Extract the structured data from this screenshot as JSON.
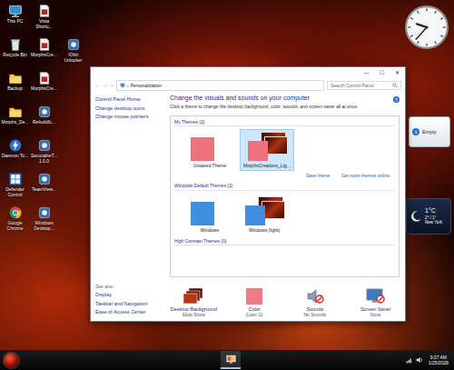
{
  "desktop_icons": [
    {
      "label": "This PC",
      "kind": "pc"
    },
    {
      "label": "Recycle Bin",
      "kind": "bin"
    },
    {
      "label": "Backup",
      "kind": "folder"
    },
    {
      "label": "Morphs_De...",
      "kind": "folder"
    },
    {
      "label": "Daemon To...",
      "kind": "lightning"
    },
    {
      "label": "Defender Control",
      "kind": "windows"
    },
    {
      "label": "Google Chrome",
      "kind": "chrome"
    },
    {
      "label": "Vista Shortc...",
      "kind": "file"
    },
    {
      "label": "MorphsCre...",
      "kind": "file"
    },
    {
      "label": "MorphsCre...",
      "kind": "file"
    },
    {
      "label": "RebuildIc...",
      "kind": "app"
    },
    {
      "label": "SecurableT... 1.0.0",
      "kind": "app"
    },
    {
      "label": "TeamView...",
      "kind": "app"
    },
    {
      "label": "Windows Desktop...",
      "kind": "app"
    },
    {
      "label": "IObit Unlocker",
      "kind": "app"
    }
  ],
  "gadgets": {
    "clock": {
      "hour": 9,
      "minute": 37
    },
    "recycle": {
      "info_icon": "i",
      "status": "Empty"
    },
    "weather": {
      "temperature": "1°C",
      "range": "2° / 1°",
      "city": "New York"
    }
  },
  "window": {
    "controls": [
      "—",
      "☐",
      "✕"
    ],
    "nav": [
      "←",
      "→",
      "↑"
    ],
    "breadcrumb": [
      "›",
      "Personalization"
    ],
    "search": {
      "placeholder": "Search Control Panel"
    },
    "help": "?"
  },
  "sidebar": {
    "links": [
      {
        "label": "Control Panel Home",
        "kind": "home"
      },
      {
        "label": "Change desktop icons",
        "kind": "link"
      },
      {
        "label": "Change mouse pointers",
        "kind": "link"
      }
    ],
    "see_also": {
      "title": "See also",
      "links": [
        "Display",
        "Taskbar and Navigation",
        "Ease of Access Center"
      ]
    }
  },
  "content": {
    "heading": "Change the visuals and sounds on your computer",
    "description": "Click a theme to change the desktop background, color, sounds, and screen saver all at once."
  },
  "theme_groups": [
    {
      "title": "My Themes (2)",
      "themes": [
        {
          "name": "Unsaved Theme",
          "selected": false,
          "kind": "color-only",
          "color": "#f0707e"
        },
        {
          "name": "MorphsCreations_Lig...",
          "selected": true,
          "kind": "with-images",
          "color": "#f0707e"
        }
      ],
      "links": [
        "Save theme",
        "Get more themes online"
      ]
    },
    {
      "title": "Windows Default Themes (2)",
      "themes": [
        {
          "name": "Windows",
          "selected": false,
          "kind": "color-only",
          "color": "#3d8fe0"
        },
        {
          "name": "Windows (light)",
          "selected": false,
          "kind": "with-images",
          "color": "#3d8fe0"
        }
      ],
      "links": []
    },
    {
      "title": "High Contrast Themes (0)",
      "themes": [],
      "links": []
    }
  ],
  "settings": [
    {
      "label": "Desktop Background",
      "value": "Slide Show",
      "kind": "background"
    },
    {
      "label": "Color",
      "value": "Color 11",
      "kind": "color"
    },
    {
      "label": "Sounds",
      "value": "No Sounds",
      "kind": "sounds"
    },
    {
      "label": "Screen Saver",
      "value": "None",
      "kind": "screensaver"
    }
  ],
  "taskbar": {
    "time": "9:37 AM",
    "date": "1/25/2026"
  }
}
